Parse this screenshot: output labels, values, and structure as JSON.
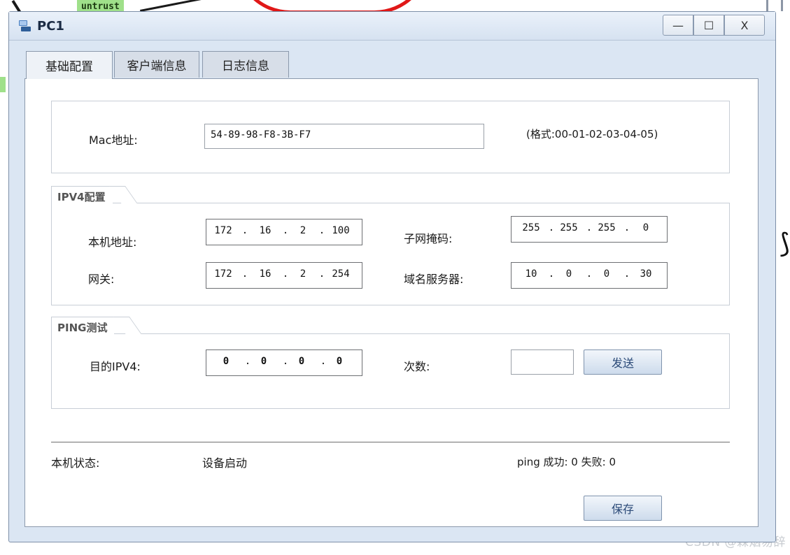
{
  "background": {
    "tag_text": "untrust",
    "watermark": "CSDN @霖烟易辞"
  },
  "window": {
    "title": "PC1",
    "controls": {
      "minimize": "—",
      "maximize": "☐",
      "close": "X"
    }
  },
  "tabs": [
    {
      "label": "基础配置",
      "active": true
    },
    {
      "label": "客户端信息",
      "active": false
    },
    {
      "label": "日志信息",
      "active": false
    }
  ],
  "mac": {
    "label": "Mac地址:",
    "value": "54-89-98-F8-3B-F7",
    "format_hint": "(格式:00-01-02-03-04-05)"
  },
  "ipv4": {
    "legend": "IPV4配置",
    "local_ip_label": "本机地址:",
    "local_ip": [
      "172",
      "16",
      "2",
      "100"
    ],
    "subnet_label": "子网掩码:",
    "subnet": [
      "255",
      "255",
      "255",
      "0"
    ],
    "gateway_label": "网关:",
    "gateway": [
      "172",
      "16",
      "2",
      "254"
    ],
    "dns_label": "域名服务器:",
    "dns": [
      "10",
      "0",
      "0",
      "30"
    ]
  },
  "ping": {
    "legend": "PING测试",
    "target_label": "目的IPV4:",
    "target": [
      "0",
      "0",
      "0",
      "0"
    ],
    "count_label": "次数:",
    "count_value": "",
    "send_label": "发送"
  },
  "status": {
    "label": "本机状态:",
    "value": "设备启动",
    "ping_result": "ping 成功: 0 失败: 0"
  },
  "save_label": "保存",
  "colors": {
    "window_bg": "#dbe6f3",
    "button_text": "#2b4a78",
    "arc_red": "#e01818",
    "tag_green": "#9fe08a"
  }
}
